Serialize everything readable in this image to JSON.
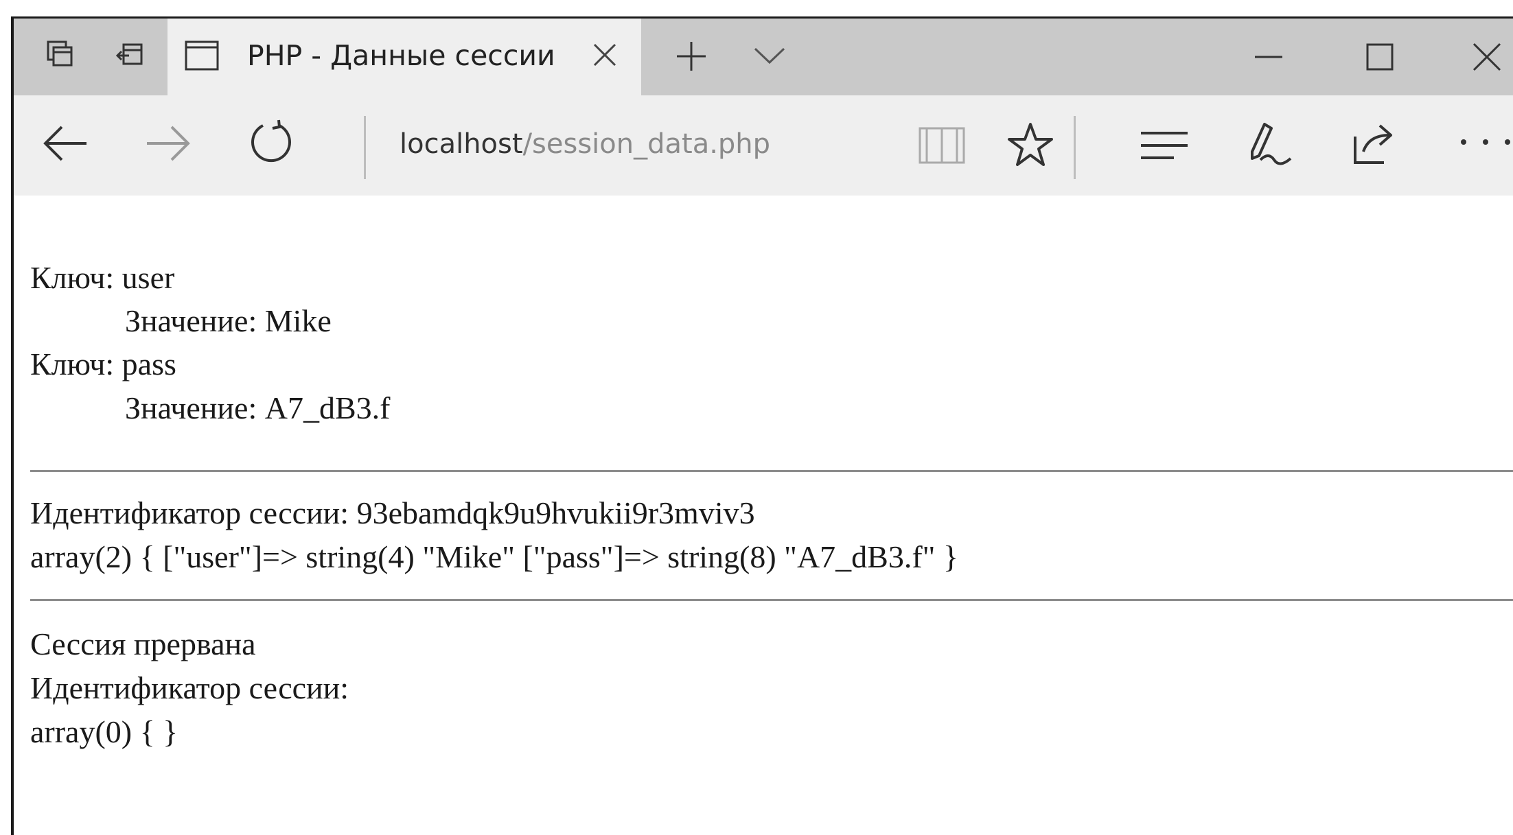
{
  "browser": {
    "tab_title": "PHP - Данные сессии",
    "address": {
      "host": "localhost",
      "path": "/session_data.php"
    },
    "icons": {
      "tab_actions": [
        "tabs-aside-icon",
        "set-tabs-aside-icon"
      ],
      "tab": [
        "page-icon",
        "close-tab-icon",
        "new-tab-icon",
        "tab-preview-chevron-icon"
      ],
      "window_controls": [
        "minimize-icon",
        "maximize-icon",
        "close-window-icon"
      ],
      "nav": [
        "back-icon",
        "forward-icon",
        "refresh-icon"
      ],
      "toolbar": [
        "reading-view-icon",
        "favorite-star-icon",
        "hub-icon",
        "web-note-icon",
        "share-icon",
        "more-icon"
      ]
    }
  },
  "page": {
    "entries": [
      {
        "key_line": "Ключ: user",
        "value_line": "Значение: Mike"
      },
      {
        "key_line": "Ключ: pass",
        "value_line": "Значение: A7_dB3.f"
      }
    ],
    "session_id_line": "Идентификатор сессии: 93ebamdqk9u9hvukii9r3mviv3",
    "dump_line": "array(2) { [\"user\"]=> string(4) \"Mike\" [\"pass\"]=> string(8) \"A7_dB3.f\" }",
    "destroyed_line": "Сессия прервана",
    "empty_session_id_line": "Идентификатор сессии:",
    "empty_dump_line": "array(0) { }"
  },
  "colors": {
    "titlebar": "#c9c9c9",
    "active_tab": "#efefef",
    "toolbar": "#efefef",
    "divider": "#8c8c8c"
  }
}
